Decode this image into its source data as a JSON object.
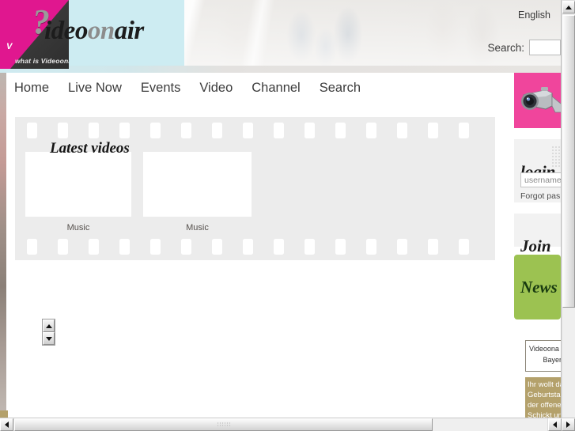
{
  "site": {
    "wordmark": {
      "part1": "V",
      "part2": "ideo",
      "part3": "on",
      "part4": "air"
    },
    "corner_banner": {
      "text": "V",
      "question_mark": "?",
      "caption": "what is Videoonair"
    }
  },
  "header": {
    "language_link": "English",
    "search_label": "Search:",
    "search_value": "",
    "search_placeholder": ""
  },
  "nav": {
    "items": [
      {
        "label": "Home"
      },
      {
        "label": "Live Now"
      },
      {
        "label": "Events"
      },
      {
        "label": "Video"
      },
      {
        "label": "Channel"
      },
      {
        "label": "Search"
      }
    ]
  },
  "filmstrip": {
    "title": "Latest videos",
    "videos": [
      {
        "caption": "Music"
      },
      {
        "caption": "Music"
      }
    ]
  },
  "sidebar": {
    "camera_icon": "video-camera-icon",
    "login": {
      "heading": "login",
      "username_value": "username",
      "username_placeholder": "username",
      "forgot_link": "Forgot pas"
    },
    "join": {
      "heading": "Join"
    },
    "news": {
      "heading": "News",
      "item_box": {
        "line1": "Videoona",
        "line2": "Bayeri"
      },
      "body_lines": [
        "Ihr wollt da",
        "Geburtstag",
        "der offener",
        "Schickt uns"
      ]
    }
  },
  "chrome": {
    "v_scroll_up": "▲",
    "v_scroll_down": "▼",
    "h_scroll_left": "◀",
    "h_scroll_right": "▶"
  },
  "colors": {
    "brand_pink": "#e0178f",
    "camera_pink": "#f0459c",
    "news_green": "#9cc251",
    "news_khaki": "#b4a16b",
    "header_cyan": "#cdecf2",
    "filmstrip_gray": "#ececec"
  }
}
